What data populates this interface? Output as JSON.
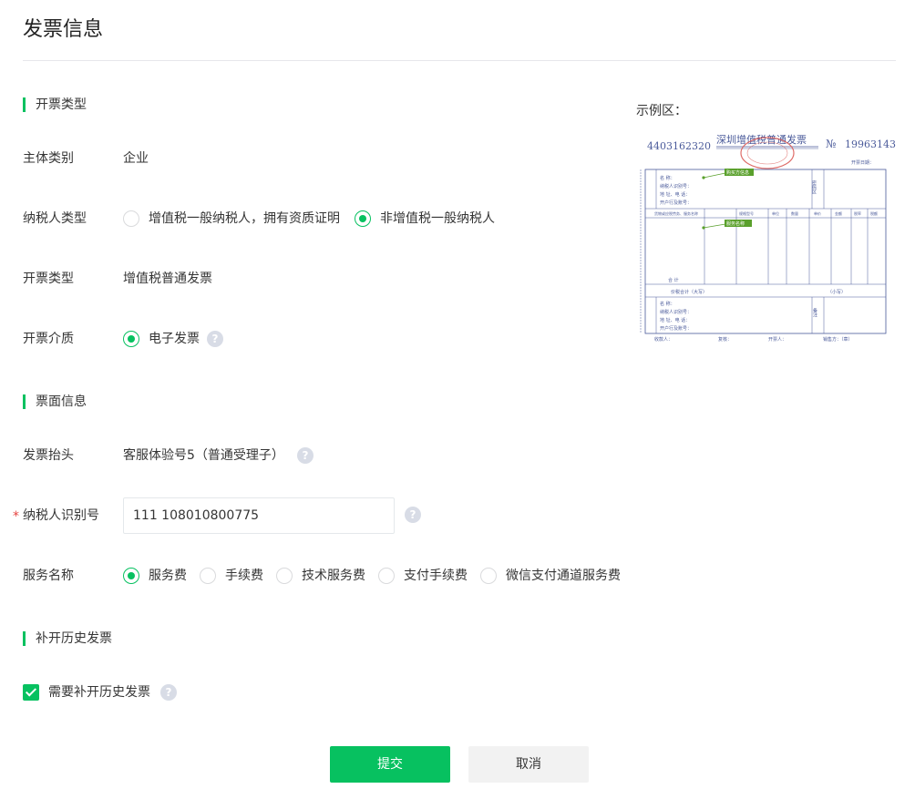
{
  "page": {
    "title": "发票信息"
  },
  "sections": {
    "invoice_type": "开票类型",
    "face_info": "票面信息",
    "history": "补开历史发票"
  },
  "fields": {
    "entity_type": {
      "label": "主体类别",
      "value": "企业"
    },
    "taxpayer_type": {
      "label": "纳税人类型",
      "options": [
        "增值税一般纳税人，拥有资质证明",
        "非增值税一般纳税人"
      ],
      "selected": "非增值税一般纳税人"
    },
    "invoice_kind": {
      "label": "开票类型",
      "value": "增值税普通发票"
    },
    "invoice_medium": {
      "label": "开票介质",
      "options": [
        "电子发票"
      ],
      "selected": "电子发票"
    },
    "invoice_title": {
      "label": "发票抬头",
      "value": "客服体验号5（普通受理子）"
    },
    "taxpayer_id": {
      "label": "纳税人识别号",
      "required_mark": "*",
      "value": "111 108010800775",
      "placeholder": ""
    },
    "service_name": {
      "label": "服务名称",
      "options": [
        "服务费",
        "手续费",
        "技术服务费",
        "支付手续费",
        "微信支付通道服务费"
      ],
      "selected": "服务费"
    },
    "reissue_history": {
      "label": "需要补开历史发票",
      "checked": true
    }
  },
  "help_icon_glyph": "?",
  "actions": {
    "submit": "提交",
    "cancel": "取消"
  },
  "example": {
    "label": "示例区：",
    "invoice_code": "4403162320",
    "invoice_title": "深圳增值税普通发票",
    "number_prefix": "№",
    "invoice_number": "19963143",
    "date_label": "开票日期：",
    "buyer_tag": "购买方信息",
    "item_tag": "服务名称",
    "buyer_rows": [
      "名        称：",
      "纳税人识别号：",
      "地 址、电 话：",
      "开户行及账号："
    ],
    "password_label": "密码区",
    "columns": [
      "货物或应税劳务、服务名称",
      "规格型号",
      "单位",
      "数量",
      "单价",
      "金额",
      "税率",
      "税额"
    ],
    "total_row_label": "合        计",
    "price_tax_label": "价税合计（大写）",
    "price_tax_small": "（小写）",
    "seller_rows": [
      "名        称：",
      "纳税人识别号：",
      "地 址、电 话：",
      "开户行及账号："
    ],
    "remark_label": "备注",
    "footer": [
      "收款人：",
      "复核：",
      "开票人：",
      "销售方：（章）"
    ],
    "colors": {
      "ink": "#4a5a9a",
      "stamp": "#d9534f",
      "tag": "#5aa02c"
    }
  },
  "colors": {
    "accent": "#07c160",
    "required": "#e64340"
  }
}
